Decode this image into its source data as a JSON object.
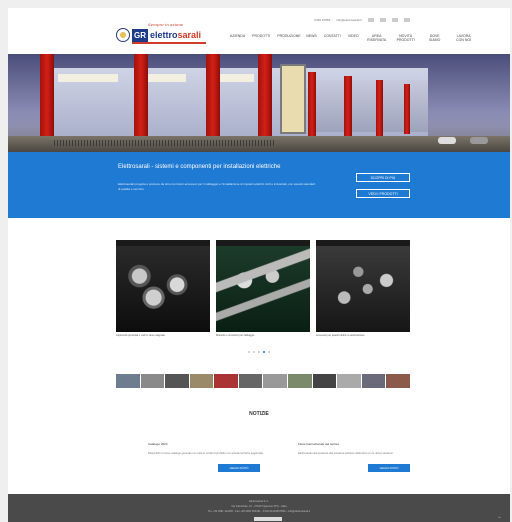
{
  "header": {
    "slogan": "Sempre in azione",
    "logo_part_a": "GR",
    "logo_part_b": "elettro",
    "logo_part_c": "sarali",
    "top_links": [
      "0383 87882",
      "info@elettrosarali.it",
      "IT",
      "EN",
      "FR",
      "DE"
    ],
    "nav": [
      "Azienda",
      "Prodotti",
      "Produzione",
      "News",
      "Contatti",
      "Video",
      "Area riservata",
      "Novità prodotti",
      "Dove siamo",
      "Lavora con noi"
    ]
  },
  "band": {
    "title": "Elettrosarali - sistemi e componenti per installazioni elettriche",
    "desc": "Elettrosarali progetta e produce da oltre trent'anni accessori per il cablaggio e l'installazione di impianti elettrici civili e industriali, con elevati standard di qualità e servizio.",
    "btn1": "SCOPRI DI PIÙ",
    "btn2": "VEDI I PRODOTTI"
  },
  "products": [
    {
      "caption": "Capicorda preisolati e nudi in rame stagnato"
    },
    {
      "caption": "Morsetti e connettori per cablaggio"
    },
    {
      "caption": "Accessori per quadri elettrici e automazione"
    }
  ],
  "news": {
    "title": "NOTIZIE",
    "left": {
      "heading": "Catalogo 2024",
      "text": "Disponibile il nuovo catalogo generale con tutte le novità di prodotto e le schede tecniche aggiornate.",
      "btn": "LEGGI DI PIÙ"
    },
    "right": {
      "heading": "Fiera internazionale del settore",
      "text": "Elettrosarali sarà presente alla prossima edizione della fiera con le ultime soluzioni.",
      "btn": "LEGGI DI PIÙ"
    }
  },
  "footer": {
    "line1": "Elettrosarali S.r.l.",
    "line2": "Via Industriale, 12 - 27029 Vigevano (PV) - Italia",
    "line3": "Tel. +39 0381 123456 - Fax +39 0381 654321 - P.IVA 01234567890 - info@elettrosarali.it"
  },
  "colors": {
    "accent": "#1f7ad3",
    "brand_red": "#d23a2a",
    "brand_blue": "#1e3b8a",
    "footer": "#4a4a4a"
  },
  "slider": {
    "dots": 5,
    "active": 3
  }
}
